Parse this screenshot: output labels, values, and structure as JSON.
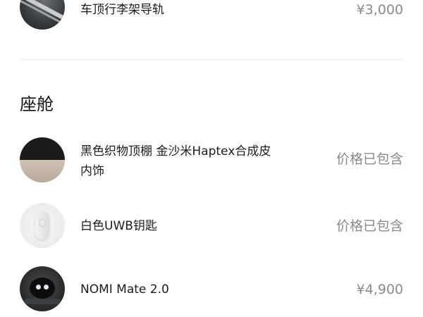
{
  "exterior_items": [
    {
      "name": "车顶行李架导轨",
      "price": "¥3,000",
      "icon": "roof-rail-image"
    }
  ],
  "cabin_section": {
    "title": "座舱",
    "items": [
      {
        "name_line1": "黑色织物顶棚 金沙米Haptex合成皮",
        "name_line2": "内饰",
        "price": "价格已包含",
        "icon": "headliner-interior-image"
      },
      {
        "name": "白色UWB钥匙",
        "price": "价格已包含",
        "icon": "uwb-key-image"
      },
      {
        "name": "NOMI Mate 2.0",
        "price": "¥4,900",
        "icon": "nomi-mate-image"
      }
    ]
  },
  "colors": {
    "divider": "#e6e6e6",
    "text_primary": "#1c1c1c",
    "text_secondary": "#8a8a8a"
  }
}
